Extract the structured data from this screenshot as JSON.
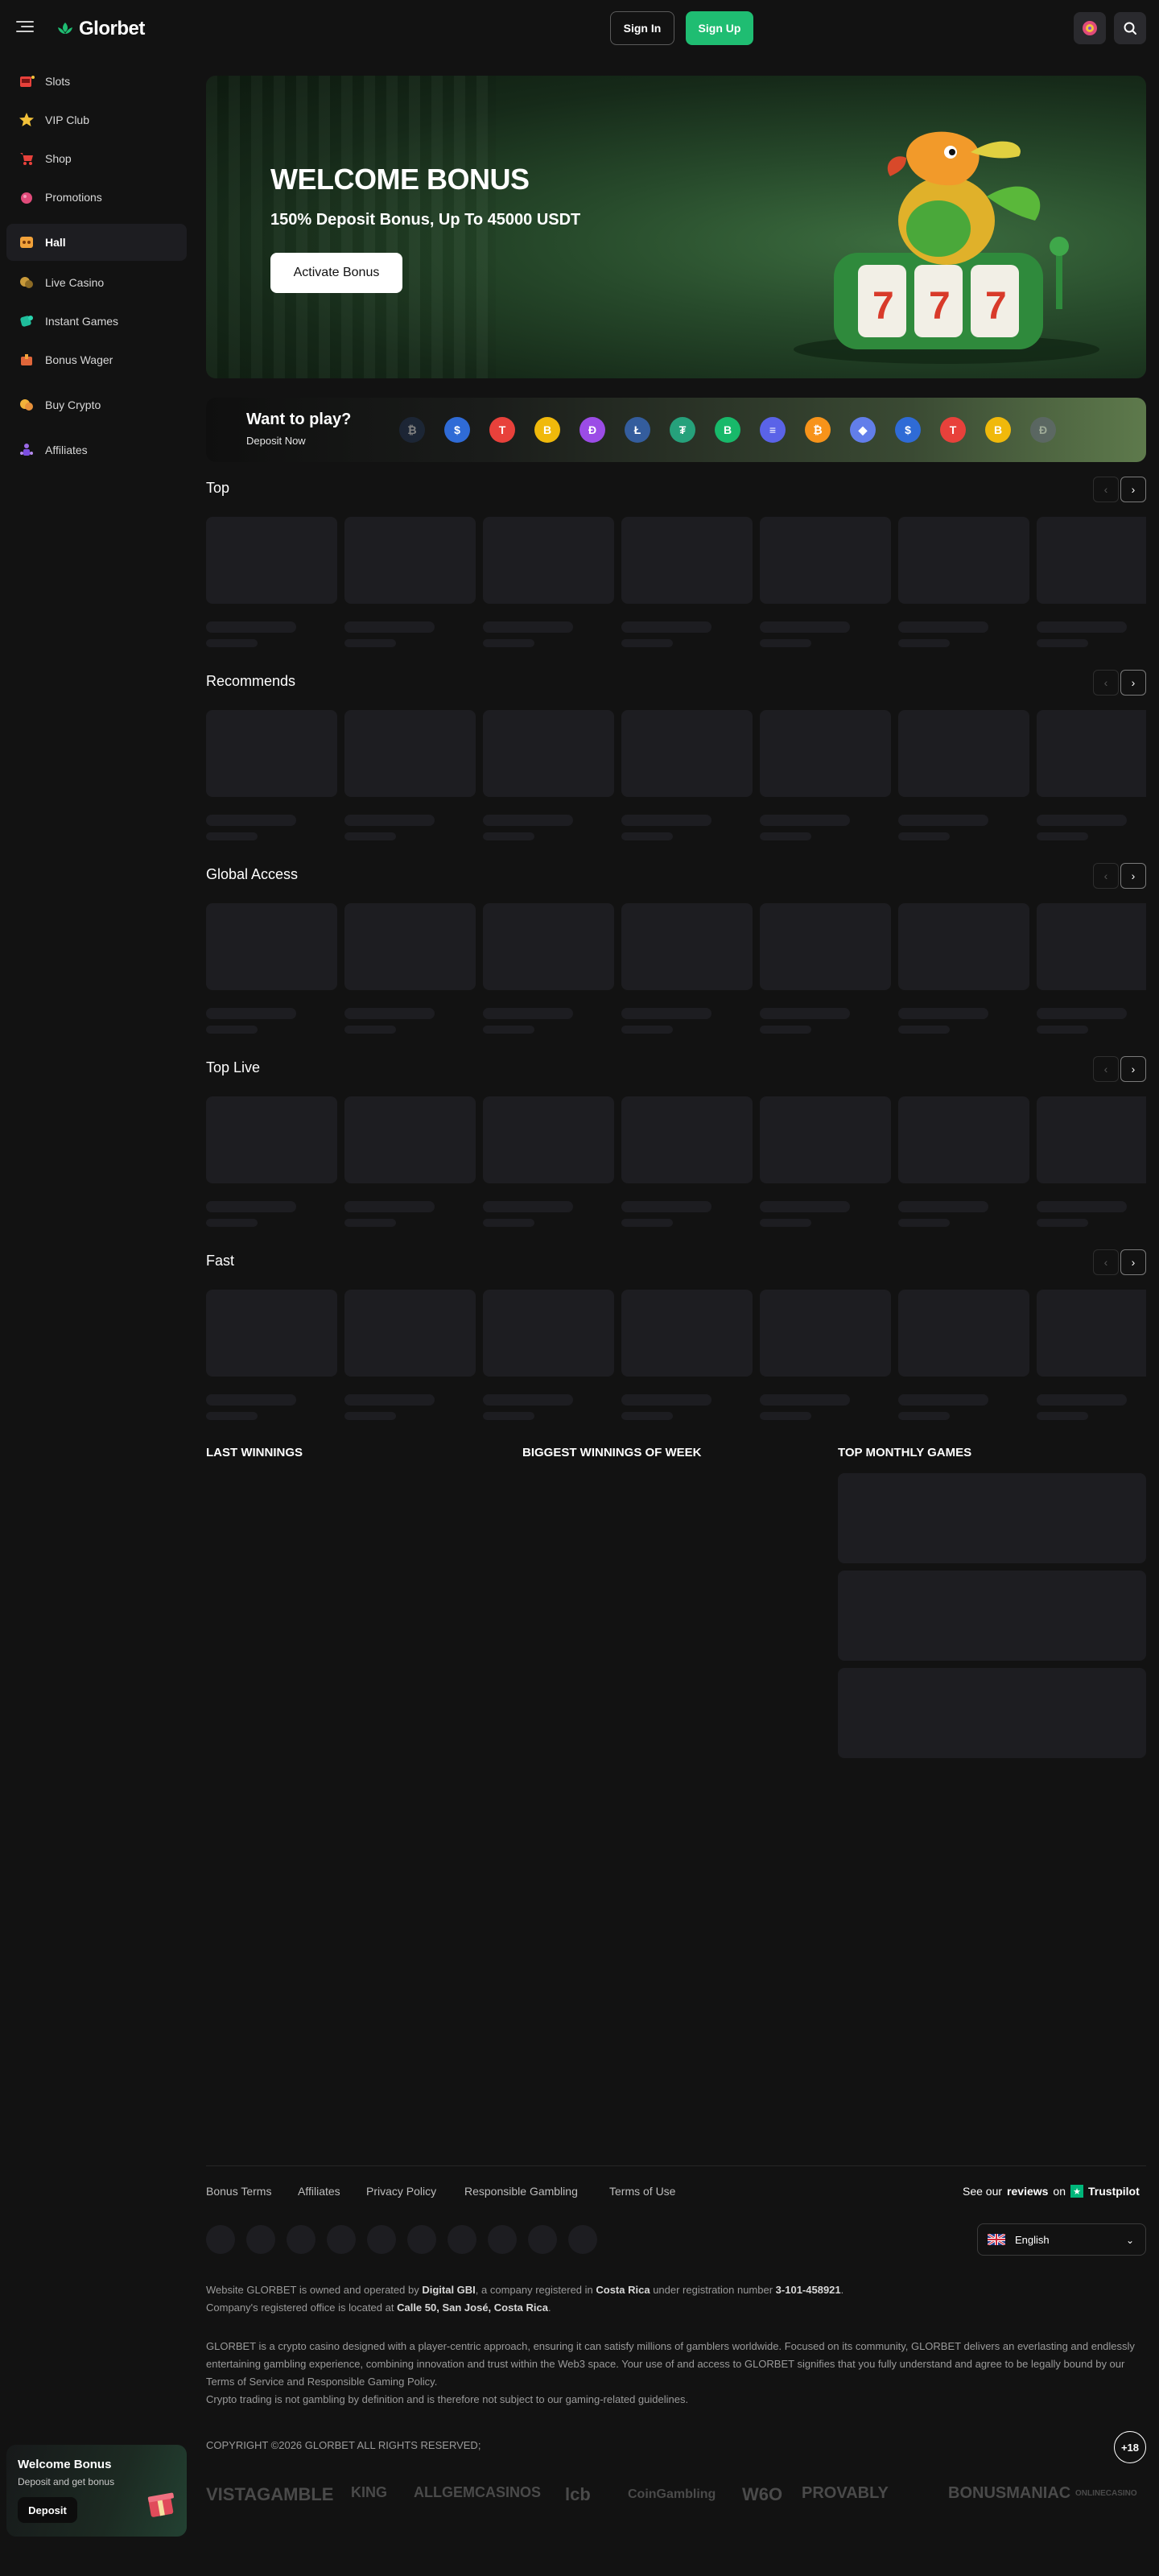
{
  "header": {
    "logo_text": "Glorbet",
    "sign_in": "Sign In",
    "sign_up": "Sign Up"
  },
  "sidebar": {
    "items": [
      {
        "label": "Slots",
        "icon": "slot-machine-icon"
      },
      {
        "label": "VIP Club",
        "icon": "vip-star-icon"
      },
      {
        "label": "Shop",
        "icon": "cart-icon"
      },
      {
        "label": "Promotions",
        "icon": "gift-icon"
      },
      {
        "label": "Hall",
        "icon": "hall-icon",
        "active": true
      },
      {
        "label": "Live Casino",
        "icon": "chips-icon"
      },
      {
        "label": "Instant Games",
        "icon": "dice-icon"
      },
      {
        "label": "Bonus Wager",
        "icon": "bonus-icon"
      },
      {
        "label": "Buy Crypto",
        "icon": "coins-icon"
      },
      {
        "label": "Affiliates",
        "icon": "affiliates-icon"
      }
    ],
    "welcome": {
      "title": "Welcome Bonus",
      "subtitle": "Deposit and get bonus",
      "button": "Deposit"
    }
  },
  "banner": {
    "title": "WELCOME BONUS",
    "subtitle": "150% Deposit Bonus, Up To 45000 USDT",
    "button": "Activate Bonus"
  },
  "want_to_play": {
    "title": "Want to play?",
    "subtitle": "Deposit Now",
    "coins": [
      {
        "symbol": "₿",
        "color": "#23365a"
      },
      {
        "symbol": "$",
        "color": "#2f6bd6"
      },
      {
        "symbol": "T",
        "color": "#e8413b"
      },
      {
        "symbol": "B",
        "color": "#f0b90b"
      },
      {
        "symbol": "Ð",
        "color": "#9b4ce6"
      },
      {
        "symbol": "Ł",
        "color": "#345d9d"
      },
      {
        "symbol": "₮",
        "color": "#26a17b"
      },
      {
        "symbol": "B",
        "color": "#18b96a"
      },
      {
        "symbol": "≡",
        "color": "#5a63e8"
      },
      {
        "symbol": "₿",
        "color": "#f7931a"
      },
      {
        "symbol": "◆",
        "color": "#627eea"
      },
      {
        "symbol": "$",
        "color": "#2f6bd6"
      },
      {
        "symbol": "T",
        "color": "#e8413b"
      },
      {
        "symbol": "B",
        "color": "#f0b90b"
      },
      {
        "symbol": "Ð",
        "color": "#6b6b8a"
      }
    ]
  },
  "sections": {
    "top": "Top",
    "recommends": "Recommends",
    "global_access": "Global Access",
    "top_live": "Top Live",
    "fast": "Fast",
    "nav_prev": "‹",
    "nav_next": "›"
  },
  "winnings": {
    "last": "LAST WINNINGS",
    "biggest": "BIGGEST WINNINGS OF WEEK",
    "top_monthly": "TOP MONTHLY GAMES"
  },
  "footer": {
    "links": [
      "Bonus Terms",
      "Affiliates",
      "Privacy Policy",
      "Responsible Gambling",
      "Terms of Use"
    ],
    "see_our": "See our",
    "reviews": "reviews",
    "on": "on",
    "trustpilot": "Trustpilot",
    "language": "English",
    "about_1a": "Website GLORBET is owned and operated by ",
    "about_1b": "Digital GBI",
    "about_1c": ", a company registered in ",
    "about_1d": "Costa Rica",
    "about_1e": " under registration number ",
    "about_1f": "3-101-458921",
    "about_1g": ".",
    "about_2a": "Company's registered office is located at ",
    "about_2b": "Calle 50, San José, Costa Rica",
    "about_2c": ".",
    "disclaimer": "GLORBET is a crypto casino designed with a player-centric approach, ensuring it can satisfy millions of gamblers worldwide. Focused on its community, GLORBET delivers an everlasting and endlessly entertaining gambling experience, combining innovation and trust within the Web3 space. Your use of and access to GLORBET signifies that you fully understand and agree to be legally bound by our Terms of Service and Responsible Gaming Policy.",
    "crypto_note": "Crypto trading is not gambling by definition and is therefore not subject to our gaming-related guidelines.",
    "copyright": "COPYRIGHT ©2026 GLORBET ALL RIGHTS RESERVED;",
    "age": "+18",
    "partners": [
      "VISTAGAMBLE",
      "KING",
      "ALLGEMCASINOS",
      "lcb",
      "CoinGambling",
      "W6O",
      "PROVABLY",
      "BONUSMANIAC",
      "ONLINECASINO"
    ]
  }
}
